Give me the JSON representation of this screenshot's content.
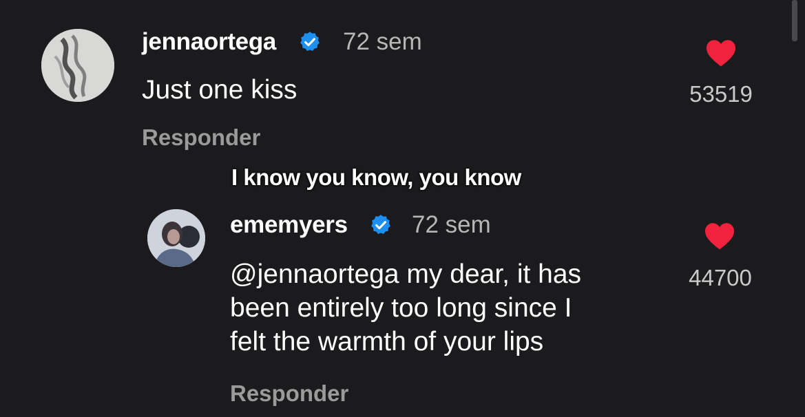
{
  "comments": [
    {
      "username": "jennaortega",
      "verified": true,
      "time": "72 sem",
      "text": "Just one kiss",
      "reply_label": "Responder",
      "likes": "53519",
      "liked": true
    },
    {
      "username": "ememyers",
      "verified": true,
      "time": "72 sem",
      "text_lines": [
        "@jennaortega my dear, it has",
        "been entirely too long since I",
        "felt the warmth of your lips"
      ],
      "reply_label": "Responder",
      "likes": "44700",
      "liked": true
    }
  ],
  "video_caption": "I know you know, you know",
  "colors": {
    "background": "#1b1b1d",
    "heart": "#f0223d",
    "verified": "#1d8ff0",
    "muted_text": "#9a9a9a"
  },
  "icons": {
    "verified": "verified-badge-icon",
    "like": "heart-icon"
  }
}
